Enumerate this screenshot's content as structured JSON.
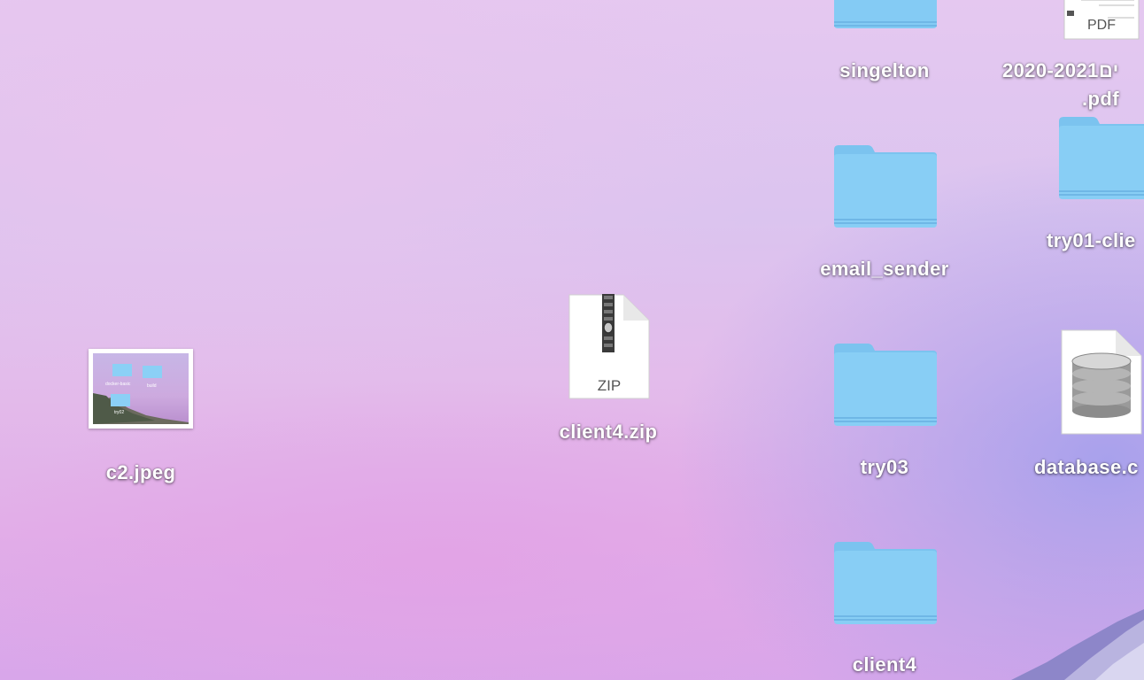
{
  "desktop": {
    "items": [
      {
        "label": "singelton",
        "type": "folder",
        "icon": "folder-icon"
      },
      {
        "label_line1": "2020-2021ים",
        "label_line2": ".pdf",
        "type": "pdf",
        "icon": "pdf-document-icon",
        "badge": "PDF"
      },
      {
        "label": "email_sender",
        "type": "folder",
        "icon": "folder-icon"
      },
      {
        "label": "try01-clie",
        "type": "folder",
        "icon": "folder-icon"
      },
      {
        "label": "client4.zip",
        "type": "zip",
        "icon": "zip-archive-icon",
        "badge": "ZIP"
      },
      {
        "label": "try03",
        "type": "folder",
        "icon": "folder-icon"
      },
      {
        "label": "database.c",
        "type": "database",
        "icon": "database-icon"
      },
      {
        "label": "c2.jpeg",
        "type": "image",
        "icon": "image-thumbnail-icon"
      },
      {
        "label": "client4",
        "type": "folder",
        "icon": "folder-icon"
      }
    ]
  },
  "thumbnail": {
    "labels": [
      "docker-basic",
      "build",
      "try02"
    ]
  },
  "colors": {
    "folder_front": "#86cdf5",
    "folder_back": "#7ec5f0",
    "label_text": "#ffffff"
  }
}
